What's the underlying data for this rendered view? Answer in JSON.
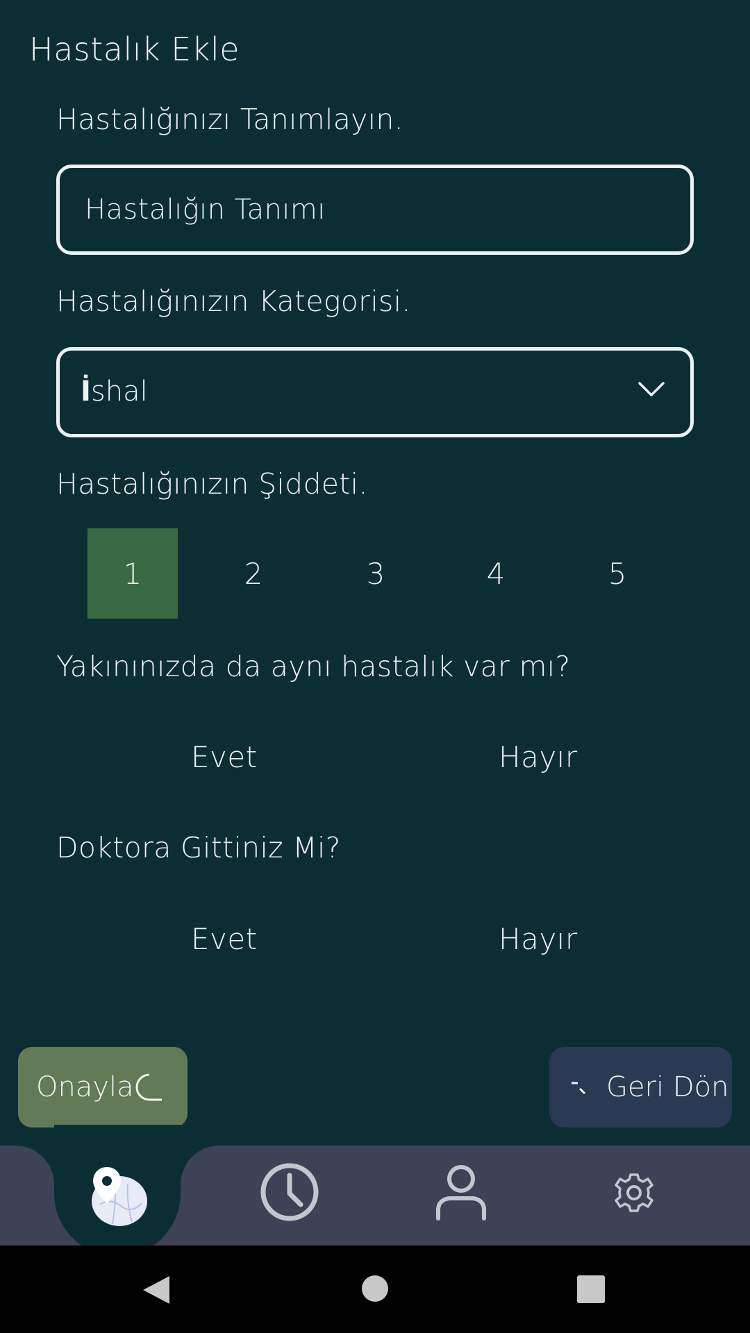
{
  "page": {
    "title": "Hastalık Ekle"
  },
  "definition": {
    "label": "Hastalığınızı Tanımlayın.",
    "placeholder": "Hastalığın Tanımı",
    "value": ""
  },
  "category": {
    "label": "Hastalığınızın Kategorisi.",
    "selected_first": "İ",
    "selected_rest": "shal"
  },
  "severity": {
    "label": "Hastalığınızın Şiddeti.",
    "options": [
      "1",
      "2",
      "3",
      "4",
      "5"
    ],
    "selected": "1",
    "selected_color": "#3a6a43"
  },
  "nearby": {
    "question": "Yakınınızda da aynı hastalık var mı?",
    "yes": "Evet",
    "no": "Hayır"
  },
  "doctor": {
    "question": "Doktora Gittiniz Mi?",
    "yes": "Evet",
    "no": "Hayır"
  },
  "actions": {
    "confirm": "Onayla",
    "back": "Geri Dön",
    "back_icon_text": "-"
  },
  "bottom_nav": {
    "items": [
      "map-pin-icon",
      "clock-icon",
      "user-icon",
      "settings-icon"
    ],
    "active": "map-pin-icon"
  },
  "system_nav": {
    "items": [
      "back-icon",
      "home-icon",
      "recents-icon"
    ]
  },
  "colors": {
    "background": "#0b2e35",
    "confirm_button": "#627a55",
    "back_button": "#2a3a52",
    "nav_bar": "#3e4256"
  }
}
